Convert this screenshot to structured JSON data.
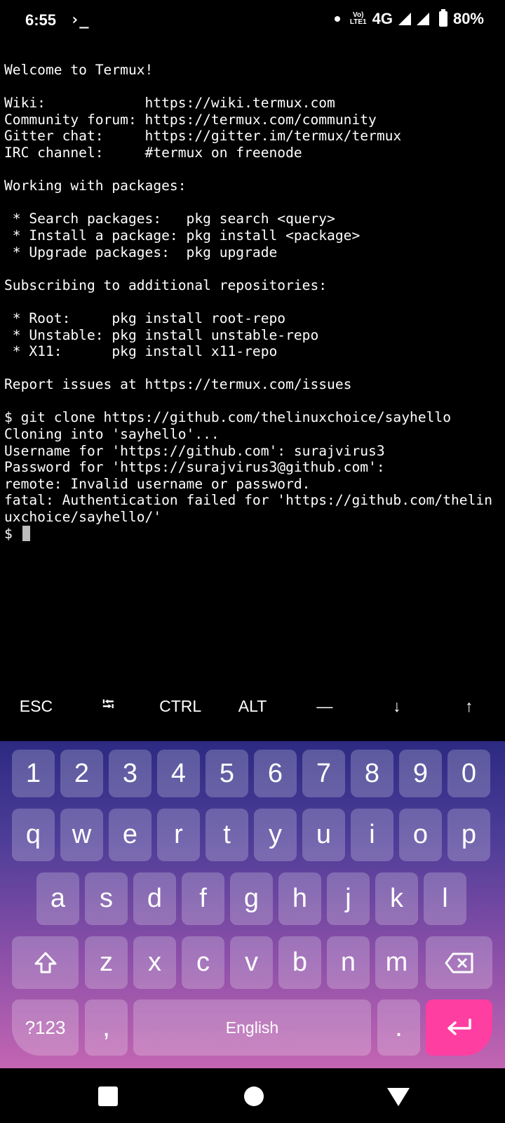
{
  "status_bar": {
    "time": "6:55",
    "terminal_glyph": "›_",
    "volte": "Vo)\nLTE1",
    "network": "4G",
    "battery": "80%"
  },
  "terminal": {
    "lines": [
      "Welcome to Termux!",
      "",
      "Wiki:            https://wiki.termux.com",
      "Community forum: https://termux.com/community",
      "Gitter chat:     https://gitter.im/termux/termux",
      "IRC channel:     #termux on freenode",
      "",
      "Working with packages:",
      "",
      " * Search packages:   pkg search <query>",
      " * Install a package: pkg install <package>",
      " * Upgrade packages:  pkg upgrade",
      "",
      "Subscribing to additional repositories:",
      "",
      " * Root:     pkg install root-repo",
      " * Unstable: pkg install unstable-repo",
      " * X11:      pkg install x11-repo",
      "",
      "Report issues at https://termux.com/issues",
      "",
      "$ git clone https://github.com/thelinuxchoice/sayhello",
      "Cloning into 'sayhello'...",
      "Username for 'https://github.com': surajvirus3",
      "Password for 'https://surajvirus3@github.com':",
      "remote: Invalid username or password.",
      "fatal: Authentication failed for 'https://github.com/thelin",
      "uxchoice/sayhello/'"
    ],
    "prompt": "$ "
  },
  "extra_keys": [
    "ESC",
    "⭾",
    "CTRL",
    "ALT",
    "—",
    "↓",
    "↑"
  ],
  "keyboard": {
    "row_numbers": [
      "1",
      "2",
      "3",
      "4",
      "5",
      "6",
      "7",
      "8",
      "9",
      "0"
    ],
    "row1": [
      "q",
      "w",
      "e",
      "r",
      "t",
      "y",
      "u",
      "i",
      "o",
      "p"
    ],
    "row2": [
      "a",
      "s",
      "d",
      "f",
      "g",
      "h",
      "j",
      "k",
      "l"
    ],
    "row3": [
      "z",
      "x",
      "c",
      "v",
      "b",
      "n",
      "m"
    ],
    "symbols_label": "?123",
    "comma": ",",
    "space_label": "English",
    "period": ".",
    "colors": {
      "enter": "#ff3ea1",
      "top": "#2c2a82",
      "bottom": "#c365b2"
    }
  },
  "icons": {
    "shift": "shift-icon",
    "backspace": "backspace-icon",
    "enter": "enter-icon",
    "nav_recent": "recent-apps-icon",
    "nav_home": "home-icon",
    "nav_back": "back-icon"
  }
}
